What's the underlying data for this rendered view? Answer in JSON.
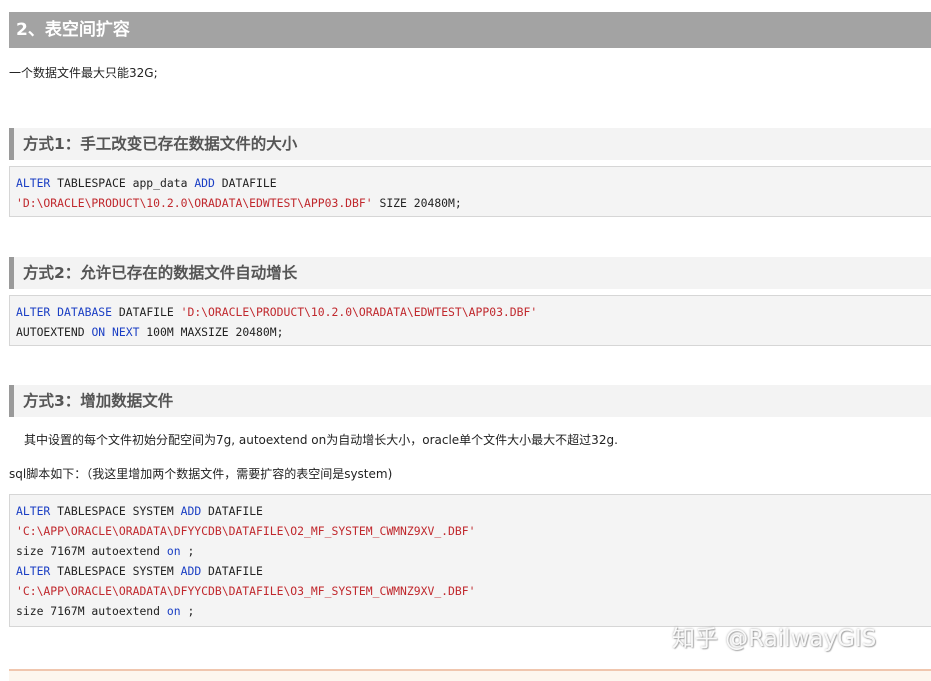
{
  "section_title": "2、表空间扩容",
  "intro": "一个数据文件最大只能32G;",
  "method1": {
    "title": "方式1：手工改变已存在数据文件的大小",
    "code": [
      [
        [
          "kw",
          "ALTER"
        ],
        [
          "t",
          " TABLESPACE app_data "
        ],
        [
          "kw",
          "ADD"
        ],
        [
          "t",
          " DATAFILE"
        ]
      ],
      [
        [
          "str",
          "'D:\\ORACLE\\PRODUCT\\10.2.0\\ORADATA\\EDWTEST\\APP03.DBF'"
        ],
        [
          "t",
          " SIZE 20480M;"
        ]
      ]
    ]
  },
  "method2": {
    "title": "方式2：允许已存在的数据文件自动增长",
    "code": [
      [
        [
          "kw",
          "ALTER"
        ],
        [
          "t",
          " "
        ],
        [
          "kw",
          "DATABASE"
        ],
        [
          "t",
          " DATAFILE "
        ],
        [
          "str",
          "'D:\\ORACLE\\PRODUCT\\10.2.0\\ORADATA\\EDWTEST\\APP03.DBF'"
        ]
      ],
      [
        [
          "t",
          "AUTOEXTEND "
        ],
        [
          "kw",
          "ON"
        ],
        [
          "t",
          " "
        ],
        [
          "kw",
          "NEXT"
        ],
        [
          "t",
          " 100M MAXSIZE 20480M;"
        ]
      ]
    ]
  },
  "method3": {
    "title": "方式3：增加数据文件",
    "desc": "其中设置的每个文件初始分配空间为7g, autoextend on为自动增长大小，oracle单个文件大小最大不超过32g.",
    "sql_intro": "sql脚本如下：（我这里增加两个数据文件，需要扩容的表空间是system)",
    "code": [
      [
        [
          "kw",
          "ALTER"
        ],
        [
          "t",
          " TABLESPACE SYSTEM "
        ],
        [
          "kw",
          "ADD"
        ],
        [
          "t",
          " DATAFILE"
        ]
      ],
      [
        [
          "str",
          "'C:\\APP\\ORACLE\\ORADATA\\DFYYCDB\\DATAFILE\\O2_MF_SYSTEM_CWMNZ9XV_.DBF'"
        ]
      ],
      [
        [
          "t",
          "size 7167M autoextend "
        ],
        [
          "kw",
          "on"
        ],
        [
          "t",
          " ;"
        ]
      ],
      [
        [
          "kw",
          "ALTER"
        ],
        [
          "t",
          " TABLESPACE SYSTEM "
        ],
        [
          "kw",
          "ADD"
        ],
        [
          "t",
          " DATAFILE"
        ]
      ],
      [
        [
          "str",
          "'C:\\APP\\ORACLE\\ORADATA\\DFYYCDB\\DATAFILE\\O3_MF_SYSTEM_CWMNZ9XV_.DBF'"
        ]
      ],
      [
        [
          "t",
          "size 7167M autoextend "
        ],
        [
          "kw",
          "on"
        ],
        [
          "t",
          " ;"
        ]
      ]
    ]
  },
  "watermark": "知乎 @RailwayGIS"
}
